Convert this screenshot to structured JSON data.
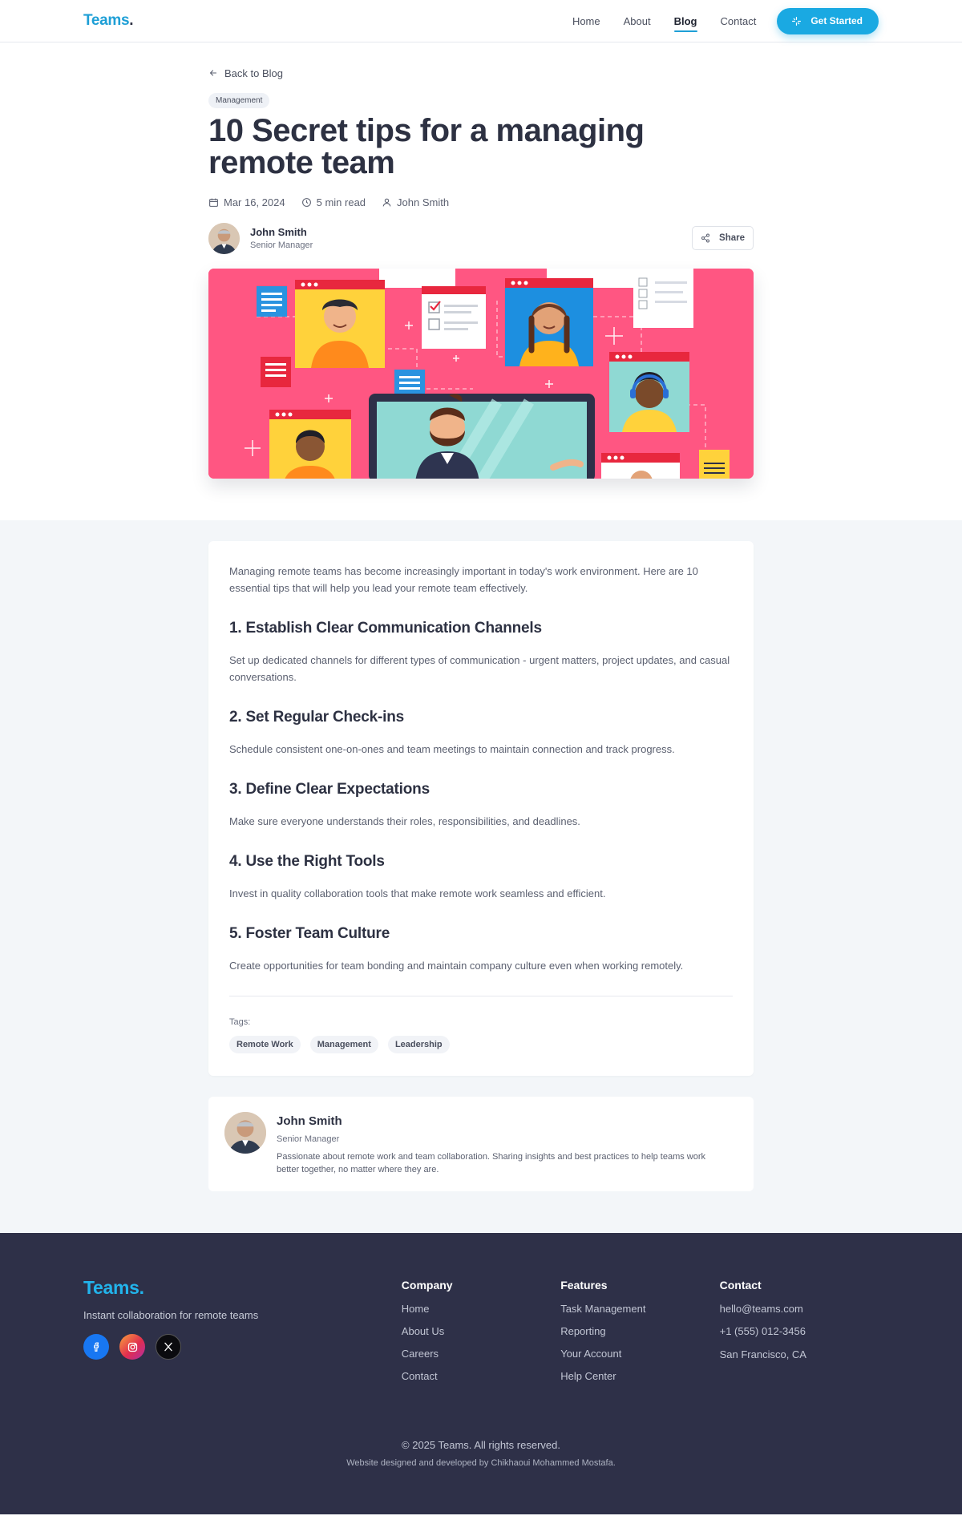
{
  "nav": {
    "logo": "Teams",
    "logo_dot": ".",
    "links": [
      "Home",
      "About",
      "Blog",
      "Contact"
    ],
    "active": "Blog",
    "cta": "Get Started"
  },
  "article": {
    "back": "Back to Blog",
    "category": "Management",
    "title": "10 Secret tips for a managing remote team",
    "date": "Mar 16, 2024",
    "read_time": "5 min read",
    "author_meta": "John Smith",
    "author_name": "John Smith",
    "author_role": "Senior Manager",
    "share": "Share",
    "intro": "Managing remote teams has become increasingly important in today's work environment. Here are 10 essential tips that will help you lead your remote team effectively.",
    "sections": [
      {
        "heading": "1. Establish Clear Communication Channels",
        "body": "Set up dedicated channels for different types of communication - urgent matters, project updates, and casual conversations."
      },
      {
        "heading": "2. Set Regular Check-ins",
        "body": "Schedule consistent one-on-ones and team meetings to maintain connection and track progress."
      },
      {
        "heading": "3. Define Clear Expectations",
        "body": "Make sure everyone understands their roles, responsibilities, and deadlines."
      },
      {
        "heading": "4. Use the Right Tools",
        "body": "Invest in quality collaboration tools that make remote work seamless and efficient."
      },
      {
        "heading": "5. Foster Team Culture",
        "body": "Create opportunities for team bonding and maintain company culture even when working remotely."
      }
    ],
    "tags_label": "Tags:",
    "tags": [
      "Remote Work",
      "Management",
      "Leadership"
    ]
  },
  "bio": {
    "name": "John Smith",
    "role": "Senior Manager",
    "description": "Passionate about remote work and team collaboration. Sharing insights and best practices to help teams work better together, no matter where they are."
  },
  "footer": {
    "logo": "Teams.",
    "tagline": "Instant collaboration for remote teams",
    "socials": [
      "facebook-icon",
      "instagram-icon",
      "x-icon"
    ],
    "company": {
      "heading": "Company",
      "links": [
        "Home",
        "About Us",
        "Careers",
        "Contact"
      ]
    },
    "features": {
      "heading": "Features",
      "links": [
        "Task Management",
        "Reporting",
        "Your Account",
        "Help Center"
      ]
    },
    "contact": {
      "heading": "Contact",
      "links": [
        "hello@teams.com",
        "+1 (555) 012-3456",
        "San Francisco, CA"
      ]
    },
    "copyright": "© 2025 Teams. All rights reserved.",
    "credit": "Website designed and developed by Chikhaoui Mohammed Mostafa."
  },
  "colors": {
    "accent": "#1aa9e2",
    "hero": "#ff5682",
    "footer": "#2e3048",
    "text": "#2d3142"
  }
}
